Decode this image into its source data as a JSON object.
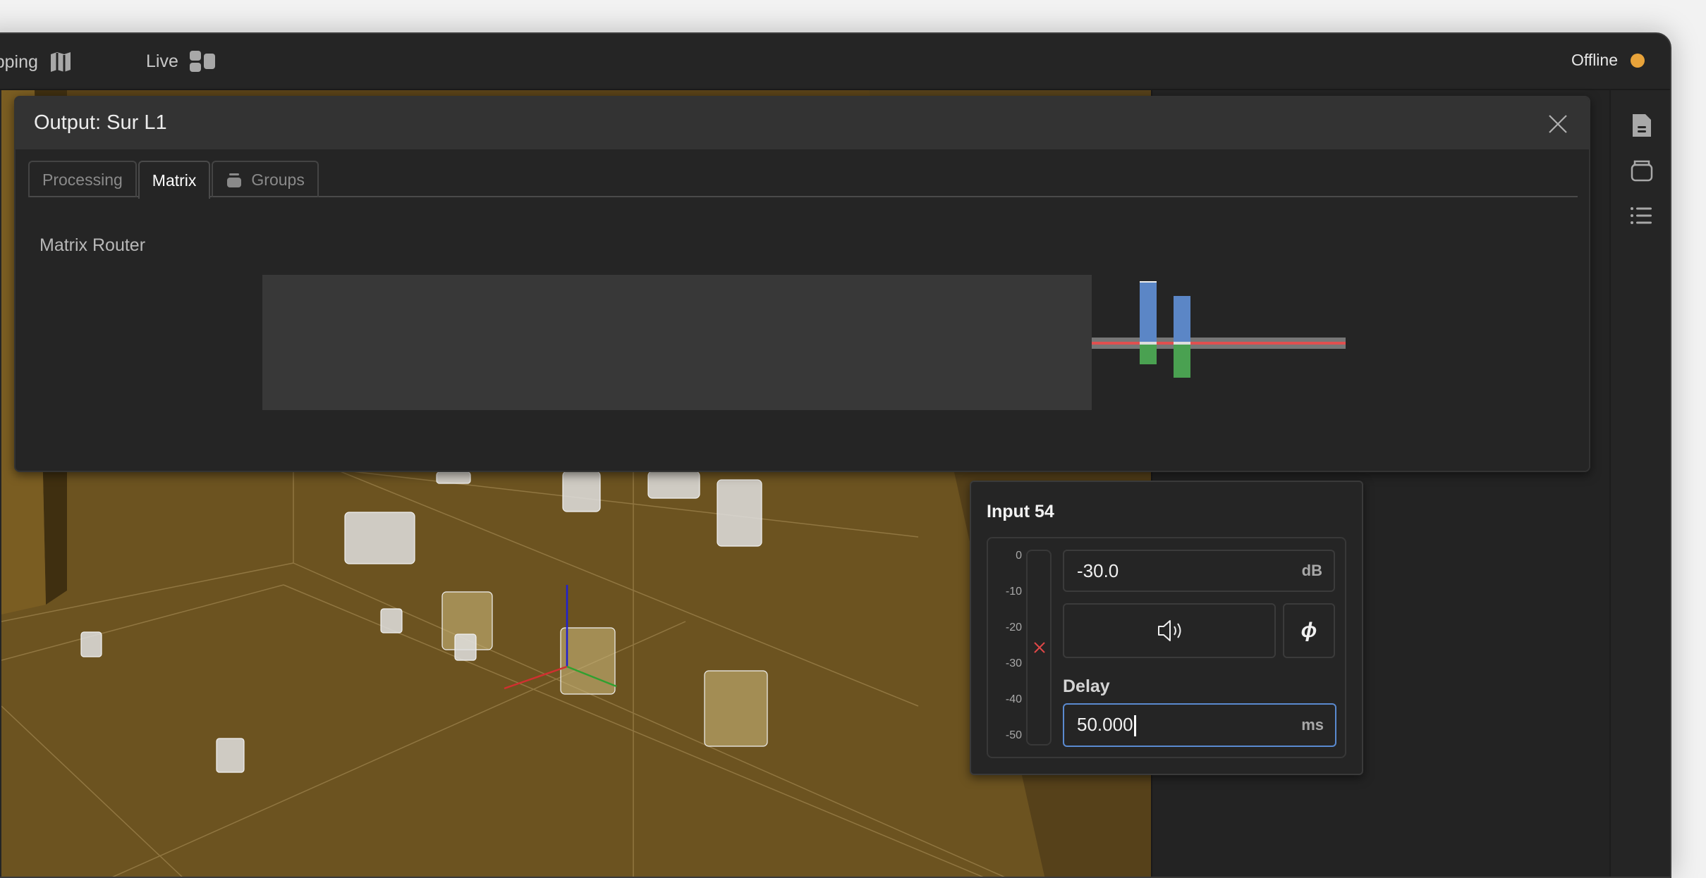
{
  "topbar": {
    "nav": [
      {
        "label": "Mapping",
        "icon": "map-icon"
      },
      {
        "label": "Live",
        "icon": "live-layout-icon"
      }
    ],
    "status": {
      "label": "Offline",
      "color": "#e8a33a"
    }
  },
  "sidebar": {
    "icons": [
      "document-icon",
      "database-icon",
      "list-icon"
    ]
  },
  "dialog": {
    "title": "Output: Sur L1",
    "tabs": [
      {
        "label": "Processing",
        "active": false
      },
      {
        "label": "Matrix",
        "active": true
      },
      {
        "label": "Groups",
        "active": false,
        "icon": "database-icon"
      }
    ],
    "section_label": "Matrix Router",
    "meters": {
      "colors": {
        "level": "#5b86c6",
        "gain": "#4aa151",
        "threshold": "#e05050",
        "track": "#777777"
      }
    }
  },
  "input_panel": {
    "title": "Input 54",
    "scale": [
      "0",
      "-10",
      "-20",
      "-30",
      "-40",
      "-50"
    ],
    "gain": {
      "value": "-30.0",
      "unit": "dB"
    },
    "mute_icon": "speaker-icon",
    "phase_label": "ϕ",
    "delay": {
      "label": "Delay",
      "value": "50.000",
      "unit": "ms"
    },
    "focus_color": "#5a8ad0"
  }
}
